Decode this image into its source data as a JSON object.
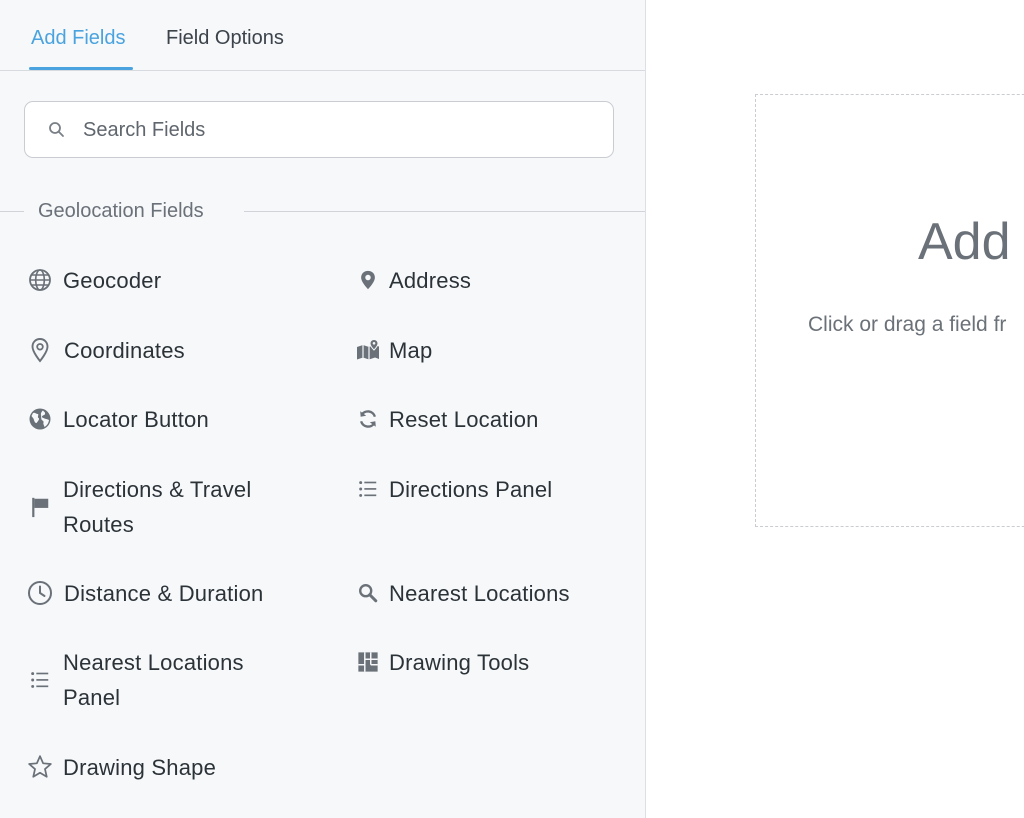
{
  "tabs": [
    {
      "label": "Add Fields",
      "active": true
    },
    {
      "label": "Field Options",
      "active": false
    }
  ],
  "search": {
    "placeholder": "Search Fields"
  },
  "section": {
    "title": "Geolocation Fields"
  },
  "fields": [
    {
      "label": "Geocoder",
      "icon": "globe-icon"
    },
    {
      "label": "Address",
      "icon": "map-marker-icon"
    },
    {
      "label": "Coordinates",
      "icon": "location-pin-icon"
    },
    {
      "label": "Map",
      "icon": "folded-map-icon"
    },
    {
      "label": "Locator Button",
      "icon": "earth-icon"
    },
    {
      "label": "Reset Location",
      "icon": "refresh-icon"
    },
    {
      "label": "Directions & Travel Routes",
      "icon": "flag-icon"
    },
    {
      "label": "Directions Panel",
      "icon": "list-icon"
    },
    {
      "label": "Distance & Duration",
      "icon": "clock-icon"
    },
    {
      "label": "Nearest Locations",
      "icon": "search-icon"
    },
    {
      "label": "Nearest Locations Panel",
      "icon": "list-icon"
    },
    {
      "label": "Drawing Tools",
      "icon": "tiles-icon"
    },
    {
      "label": "Drawing Shape",
      "icon": "star-icon"
    }
  ],
  "canvas": {
    "title": "Add",
    "subtitle": "Click or drag a field fr"
  },
  "colors": {
    "accent": "#4aa3df",
    "icon": "#6b7178",
    "text": "#2c3338"
  }
}
